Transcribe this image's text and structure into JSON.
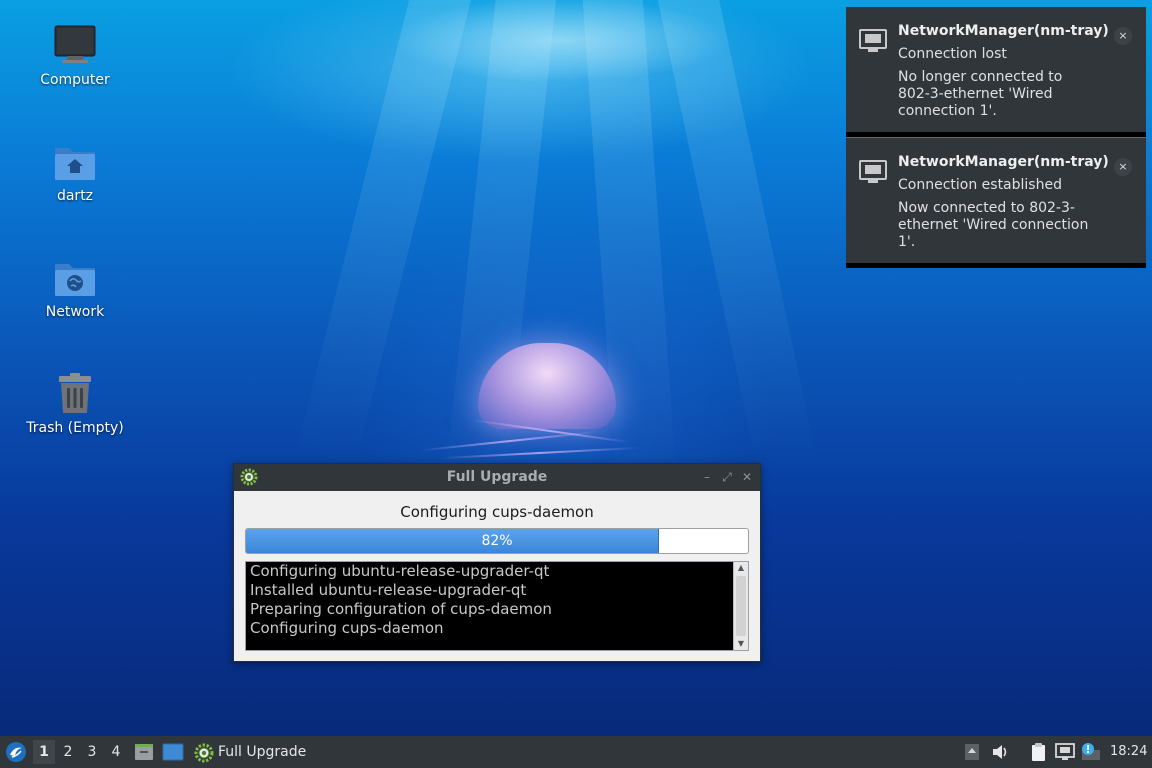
{
  "desktop": {
    "icons": [
      {
        "label": "Computer"
      },
      {
        "label": "dartz"
      },
      {
        "label": "Network"
      },
      {
        "label": "Trash (Empty)"
      }
    ]
  },
  "notifications": [
    {
      "title": "NetworkManager(nm-tray)",
      "summary": "Connection lost",
      "body": "No longer connected to 802-3-ethernet 'Wired connection 1'.",
      "close": "×"
    },
    {
      "title": "NetworkManager(nm-tray)",
      "summary": "Connection established",
      "body": "Now connected to 802-3-ethernet 'Wired connection 1'.",
      "close": "×"
    }
  ],
  "dialog": {
    "title": "Full Upgrade",
    "status": "Configuring cups-daemon",
    "progress_value": 0.82,
    "progress_label": "82%",
    "log": [
      "Configuring ubuntu-release-upgrader-qt",
      "Installed ubuntu-release-upgrader-qt",
      "Preparing configuration of cups-daemon",
      "Configuring cups-daemon"
    ],
    "minimize": "–",
    "maximize": "⤢",
    "close": "✕"
  },
  "taskbar": {
    "desktops": [
      "1",
      "2",
      "3",
      "4"
    ],
    "active_desktop": "1",
    "task_label": "Full Upgrade",
    "clock": "18:24"
  },
  "colors": {
    "panel": "#31363b",
    "progress": "#3b86d9",
    "accent": "#3daee9"
  },
  "icons": {
    "start": "lubuntu-logo-icon",
    "file_manager": "file-manager-icon",
    "show_desktop": "desktop-icon",
    "upgrade": "gear-icon",
    "tray": [
      "up-arrow-icon",
      "volume-icon",
      "clipboard-icon",
      "network-icon",
      "update-notifier-icon"
    ]
  }
}
